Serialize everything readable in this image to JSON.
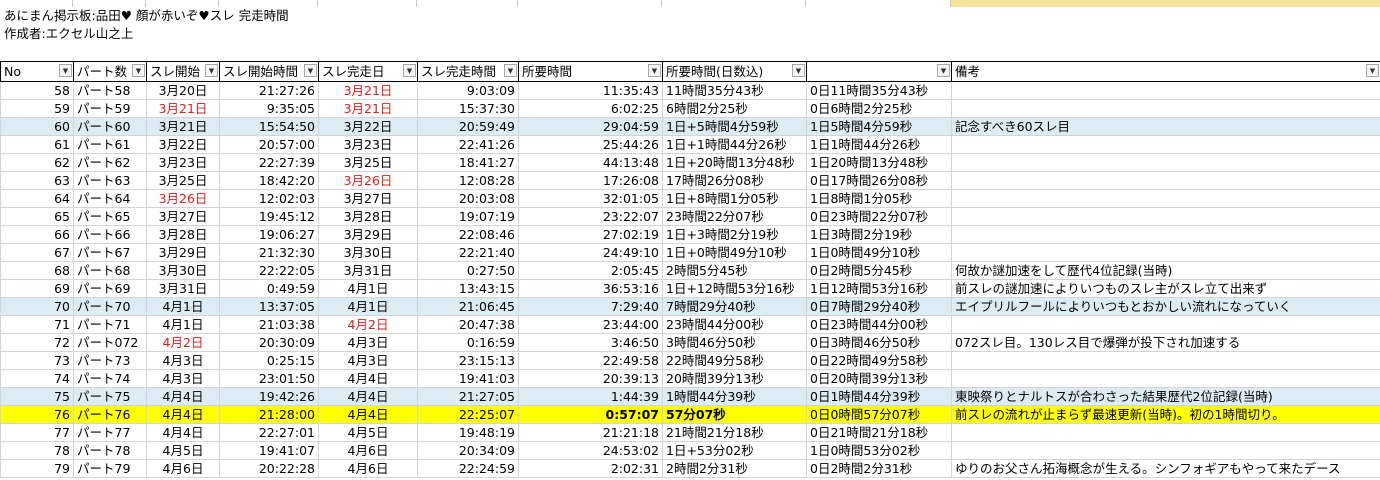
{
  "sheet": {
    "title": "あにまん掲示板:品田♥ 顔が赤いぞ♥スレ 完走時間",
    "author": "作成者:エクセル山之上"
  },
  "headers": [
    "No",
    "パート数",
    "スレ開始",
    "スレ開始時間",
    "スレ完走日",
    "スレ完走時間",
    "所要時間",
    "所要時間(日数込)",
    "",
    "備考"
  ],
  "rows": [
    {
      "no": "58",
      "part": "パート58",
      "start_date": "3月20日",
      "start_time": "21:27:26",
      "end_date": "3月21日",
      "end_time": "9:03:09",
      "duration": "11:35:43",
      "duration_text": "11時間35分43秒",
      "duration_days": "0日11時間35分43秒",
      "note": ""
    },
    {
      "no": "59",
      "part": "パート59",
      "start_date": "3月21日",
      "start_time": "9:35:05",
      "end_date": "3月21日",
      "end_time": "15:37:30",
      "duration": "6:02:25",
      "duration_text": "6時間2分25秒",
      "duration_days": "0日6時間2分25秒",
      "note": ""
    },
    {
      "no": "60",
      "part": "パート60",
      "start_date": "3月21日",
      "start_time": "15:54:50",
      "end_date": "3月22日",
      "end_time": "20:59:49",
      "duration": "29:04:59",
      "duration_text": "1日+5時間4分59秒",
      "duration_days": "1日5時間4分59秒",
      "note": "記念すべき60スレ目"
    },
    {
      "no": "61",
      "part": "パート61",
      "start_date": "3月22日",
      "start_time": "20:57:00",
      "end_date": "3月23日",
      "end_time": "22:41:26",
      "duration": "25:44:26",
      "duration_text": "1日+1時間44分26秒",
      "duration_days": "1日1時間44分26秒",
      "note": ""
    },
    {
      "no": "62",
      "part": "パート62",
      "start_date": "3月23日",
      "start_time": "22:27:39",
      "end_date": "3月25日",
      "end_time": "18:41:27",
      "duration": "44:13:48",
      "duration_text": "1日+20時間13分48秒",
      "duration_days": "1日20時間13分48秒",
      "note": ""
    },
    {
      "no": "63",
      "part": "パート63",
      "start_date": "3月25日",
      "start_time": "18:42:20",
      "end_date": "3月26日",
      "end_time": "12:08:28",
      "duration": "17:26:08",
      "duration_text": "17時間26分08秒",
      "duration_days": "0日17時間26分08秒",
      "note": ""
    },
    {
      "no": "64",
      "part": "パート64",
      "start_date": "3月26日",
      "start_time": "12:02:03",
      "end_date": "3月27日",
      "end_time": "20:03:08",
      "duration": "32:01:05",
      "duration_text": "1日+8時間1分05秒",
      "duration_days": "1日8時間1分05秒",
      "note": ""
    },
    {
      "no": "65",
      "part": "パート65",
      "start_date": "3月27日",
      "start_time": "19:45:12",
      "end_date": "3月28日",
      "end_time": "19:07:19",
      "duration": "23:22:07",
      "duration_text": "23時間22分07秒",
      "duration_days": "0日23時間22分07秒",
      "note": ""
    },
    {
      "no": "66",
      "part": "パート66",
      "start_date": "3月28日",
      "start_time": "19:06:27",
      "end_date": "3月29日",
      "end_time": "22:08:46",
      "duration": "27:02:19",
      "duration_text": "1日+3時間2分19秒",
      "duration_days": "1日3時間2分19秒",
      "note": ""
    },
    {
      "no": "67",
      "part": "パート67",
      "start_date": "3月29日",
      "start_time": "21:32:30",
      "end_date": "3月30日",
      "end_time": "22:21:40",
      "duration": "24:49:10",
      "duration_text": "1日+0時間49分10秒",
      "duration_days": "1日0時間49分10秒",
      "note": ""
    },
    {
      "no": "68",
      "part": "パート68",
      "start_date": "3月30日",
      "start_time": "22:22:05",
      "end_date": "3月31日",
      "end_time": "0:27:50",
      "duration": "2:05:45",
      "duration_text": "2時間5分45秒",
      "duration_days": "0日2時間5分45秒",
      "note": "何故か謎加速をして歴代4位記録(当時)"
    },
    {
      "no": "69",
      "part": "パート69",
      "start_date": "3月31日",
      "start_time": "0:49:59",
      "end_date": "4月1日",
      "end_time": "13:43:15",
      "duration": "36:53:16",
      "duration_text": "1日+12時間53分16秒",
      "duration_days": "1日12時間53分16秒",
      "note": "前スレの謎加速によりいつものスレ主がスレ立て出来ず"
    },
    {
      "no": "70",
      "part": "パート70",
      "start_date": "4月1日",
      "start_time": "13:37:05",
      "end_date": "4月1日",
      "end_time": "21:06:45",
      "duration": "7:29:40",
      "duration_text": "7時間29分40秒",
      "duration_days": "0日7時間29分40秒",
      "note": "エイプリルフールによりいつもとおかしい流れになっていく"
    },
    {
      "no": "71",
      "part": "パート71",
      "start_date": "4月1日",
      "start_time": "21:03:38",
      "end_date": "4月2日",
      "end_time": "20:47:38",
      "duration": "23:44:00",
      "duration_text": "23時間44分00秒",
      "duration_days": "0日23時間44分00秒",
      "note": ""
    },
    {
      "no": "72",
      "part": "パート072",
      "start_date": "4月2日",
      "start_time": "20:30:09",
      "end_date": "4月3日",
      "end_time": "0:16:59",
      "duration": "3:46:50",
      "duration_text": "3時間46分50秒",
      "duration_days": "0日3時間46分50秒",
      "note": "072スレ目。130レス目で爆弾が投下され加速する"
    },
    {
      "no": "73",
      "part": "パート73",
      "start_date": "4月3日",
      "start_time": "0:25:15",
      "end_date": "4月3日",
      "end_time": "23:15:13",
      "duration": "22:49:58",
      "duration_text": "22時間49分58秒",
      "duration_days": "0日22時間49分58秒",
      "note": ""
    },
    {
      "no": "74",
      "part": "パート74",
      "start_date": "4月3日",
      "start_time": "23:01:50",
      "end_date": "4月4日",
      "end_time": "19:41:03",
      "duration": "20:39:13",
      "duration_text": "20時間39分13秒",
      "duration_days": "0日20時間39分13秒",
      "note": ""
    },
    {
      "no": "75",
      "part": "パート75",
      "start_date": "4月4日",
      "start_time": "19:42:26",
      "end_date": "4月4日",
      "end_time": "21:27:05",
      "duration": "1:44:39",
      "duration_text": "1時間44分39秒",
      "duration_days": "0日1時間44分39秒",
      "note": "東映祭りとナルトスが合わさった結果歴代2位記録(当時)"
    },
    {
      "no": "76",
      "part": "パート76",
      "start_date": "4月4日",
      "start_time": "21:28:00",
      "end_date": "4月4日",
      "end_time": "22:25:07",
      "duration": "0:57:07",
      "duration_text": "57分07秒",
      "duration_days": "0日0時間57分07秒",
      "note": "前スレの流れが止まらず最速更新(当時)。初の1時間切り。"
    },
    {
      "no": "77",
      "part": "パート77",
      "start_date": "4月4日",
      "start_time": "22:27:01",
      "end_date": "4月5日",
      "end_time": "19:48:19",
      "duration": "21:21:18",
      "duration_text": "21時間21分18秒",
      "duration_days": "0日21時間21分18秒",
      "note": ""
    },
    {
      "no": "78",
      "part": "パート78",
      "start_date": "4月5日",
      "start_time": "19:41:07",
      "end_date": "4月6日",
      "end_time": "20:34:09",
      "duration": "24:53:02",
      "duration_text": "1日+53分02秒",
      "duration_days": "1日0時間53分02秒",
      "note": ""
    },
    {
      "no": "79",
      "part": "パート79",
      "start_date": "4月6日",
      "start_time": "20:22:28",
      "end_date": "4月6日",
      "end_time": "22:24:59",
      "duration": "2:02:31",
      "duration_text": "2時間2分31秒",
      "duration_days": "0日2時間2分31秒",
      "note": "ゆりのお父さん拓海概念が生える。シンフォギアもやって来たデース"
    }
  ],
  "colors": {
    "red_date": "#e0201c",
    "blue_row": "#dcecf4",
    "highlight_row": "#ffff00"
  },
  "icons": {
    "filter_button": "dropdown-arrow-icon"
  }
}
